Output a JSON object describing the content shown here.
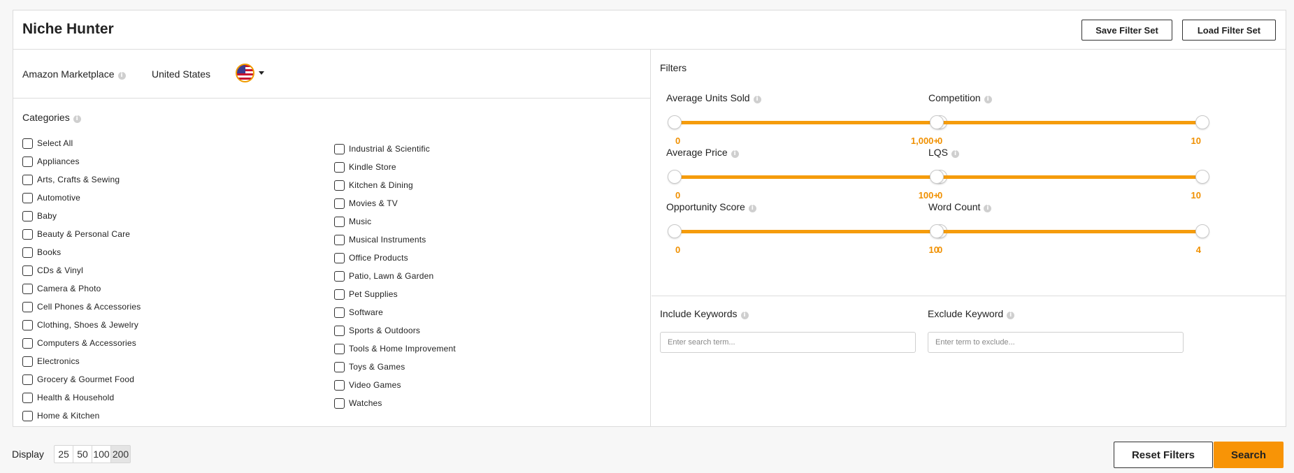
{
  "header": {
    "title": "Niche Hunter",
    "save_label": "Save Filter Set",
    "load_label": "Load Filter Set"
  },
  "marketplace": {
    "label": "Amazon Marketplace",
    "value": "United States",
    "flag_icon": "us-flag-icon"
  },
  "categories": {
    "title": "Categories",
    "col1": [
      "Select All",
      "Appliances",
      "Arts, Crafts & Sewing",
      "Automotive",
      "Baby",
      "Beauty & Personal Care",
      "Books",
      "CDs & Vinyl",
      "Camera & Photo",
      "Cell Phones & Accessories",
      "Clothing, Shoes & Jewelry",
      "Computers & Accessories",
      "Electronics",
      "Grocery & Gourmet Food",
      "Health & Household",
      "Home & Kitchen"
    ],
    "col2": [
      "Industrial & Scientific",
      "Kindle Store",
      "Kitchen & Dining",
      "Movies & TV",
      "Music",
      "Musical Instruments",
      "Office Products",
      "Patio, Lawn & Garden",
      "Pet Supplies",
      "Software",
      "Sports & Outdoors",
      "Tools & Home Improvement",
      "Toys & Games",
      "Video Games",
      "Watches"
    ]
  },
  "filters": {
    "title": "Filters",
    "items": [
      {
        "label": "Average Units Sold",
        "min": "0",
        "max": "1,000+"
      },
      {
        "label": "Competition",
        "min": "0",
        "max": "10"
      },
      {
        "label": "Average Price",
        "min": "0",
        "max": "100+"
      },
      {
        "label": "LQS",
        "min": "0",
        "max": "10"
      },
      {
        "label": "Opportunity Score",
        "min": "0",
        "max": "10"
      },
      {
        "label": "Word Count",
        "min": "0",
        "max": "4"
      }
    ]
  },
  "keywords": {
    "include_label": "Include Keywords",
    "include_placeholder": "Enter search term...",
    "exclude_label": "Exclude Keyword",
    "exclude_placeholder": "Enter term to exclude..."
  },
  "display": {
    "label": "Display",
    "options": [
      "25",
      "50",
      "100",
      "200"
    ],
    "selected": "200"
  },
  "actions": {
    "reset_label": "Reset Filters",
    "search_label": "Search"
  },
  "colors": {
    "accent": "#f89406",
    "slider": "#f59c0c"
  }
}
